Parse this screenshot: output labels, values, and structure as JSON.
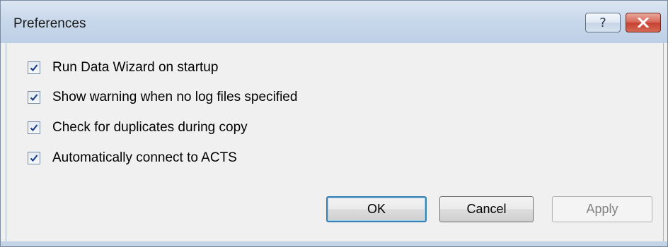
{
  "window": {
    "title": "Preferences",
    "help_label": "?",
    "close_label": "✕"
  },
  "options": [
    {
      "label": "Run Data Wizard on startup",
      "checked": true
    },
    {
      "label": "Show warning when no log files specified",
      "checked": true
    },
    {
      "label": "Check for duplicates during copy",
      "checked": true
    },
    {
      "label": "Automatically connect to ACTS",
      "checked": true
    }
  ],
  "buttons": {
    "ok": "OK",
    "cancel": "Cancel",
    "apply": "Apply"
  },
  "colors": {
    "titlebar": "#c9d8eb",
    "checkmark": "#1f3f8a",
    "ok_focus": "#3c7fb1",
    "close_red": "#c5412f"
  },
  "icons": {
    "help": "question-mark-icon",
    "close": "close-icon",
    "check": "checkmark-icon"
  }
}
